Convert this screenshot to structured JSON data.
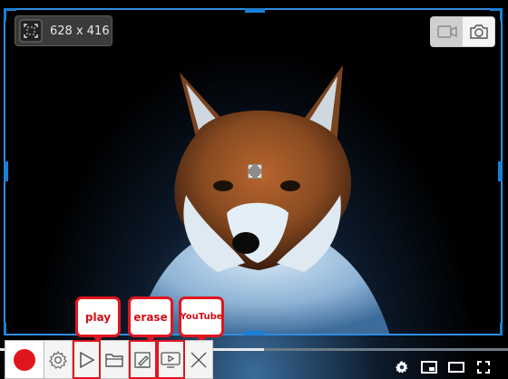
{
  "capture": {
    "size_label": "628 x 416"
  },
  "mode_switch": {
    "video_icon": "video-camera-icon",
    "screenshot_icon": "camera-icon",
    "active": "video"
  },
  "player": {
    "progress": 0.52
  },
  "toolbar": {
    "record_icon": "record-icon",
    "buttons": [
      "settings-icon",
      "play-icon",
      "folder-icon",
      "erase-icon",
      "youtube-upload-icon",
      "close-icon"
    ]
  },
  "callouts": {
    "play": "play",
    "erase": "erase",
    "youtube": "YouTube"
  },
  "youtube_controls": [
    "settings-gear-icon",
    "miniplayer-icon",
    "theater-mode-icon",
    "fullscreen-icon"
  ],
  "colors": {
    "accent_blue": "#2f8de0",
    "record_red": "#e0161e",
    "callout_red": "#e0161e"
  }
}
